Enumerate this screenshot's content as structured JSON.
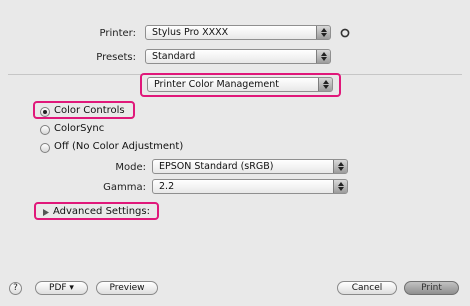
{
  "printer": {
    "label": "Printer:",
    "value": "Stylus Pro XXXX"
  },
  "presets": {
    "label": "Presets:",
    "value": "Standard"
  },
  "panel": {
    "value": "Printer Color Management"
  },
  "color_mode": {
    "options": [
      {
        "label": "Color Controls",
        "selected": true
      },
      {
        "label": "ColorSync",
        "selected": false
      },
      {
        "label": "Off (No Color Adjustment)",
        "selected": false
      }
    ]
  },
  "mode": {
    "label": "Mode:",
    "value": "EPSON Standard (sRGB)"
  },
  "gamma": {
    "label": "Gamma:",
    "value": "2.2"
  },
  "advanced": {
    "label": "Advanced Settings:"
  },
  "footer": {
    "help": "?",
    "pdf": "PDF ▾",
    "preview": "Preview",
    "cancel": "Cancel",
    "print": "Print"
  },
  "colors": {
    "highlight": "#e0187a",
    "background": "#e9e9e9"
  }
}
